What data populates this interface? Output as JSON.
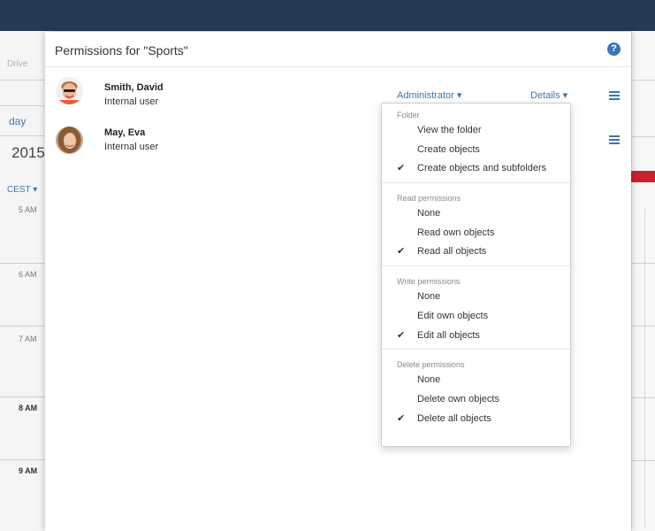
{
  "background": {
    "drive_label": "Drive",
    "today_label": "day",
    "year_label": "2015",
    "tz_label": "CEST",
    "hours": [
      "5 AM",
      "6 AM",
      "7 AM",
      "8 AM",
      "9 AM"
    ]
  },
  "modal": {
    "title": "Permissions for \"Sports\"",
    "help_icon": "?"
  },
  "users": [
    {
      "name": "Smith, David",
      "type": "Internal user",
      "role": "Administrator",
      "details": "Details"
    },
    {
      "name": "May, Eva",
      "type": "Internal user"
    }
  ],
  "dropdown": {
    "sections": [
      {
        "header": "Folder",
        "items": [
          {
            "label": "View the folder",
            "checked": false
          },
          {
            "label": "Create objects",
            "checked": false
          },
          {
            "label": "Create objects and subfolders",
            "checked": true
          }
        ]
      },
      {
        "header": "Read permissions",
        "items": [
          {
            "label": "None",
            "checked": false
          },
          {
            "label": "Read own objects",
            "checked": false
          },
          {
            "label": "Read all objects",
            "checked": true
          }
        ]
      },
      {
        "header": "Write permissions",
        "items": [
          {
            "label": "None",
            "checked": false
          },
          {
            "label": "Edit own objects",
            "checked": false
          },
          {
            "label": "Edit all objects",
            "checked": true
          }
        ]
      },
      {
        "header": "Delete permissions",
        "items": [
          {
            "label": "None",
            "checked": false
          },
          {
            "label": "Delete own objects",
            "checked": false
          },
          {
            "label": "Delete all objects",
            "checked": true
          }
        ]
      }
    ],
    "check_glyph": "✔"
  },
  "colors": {
    "accent": "#3a76b0",
    "topbar": "#253a55",
    "today_red": "#c8232c"
  }
}
